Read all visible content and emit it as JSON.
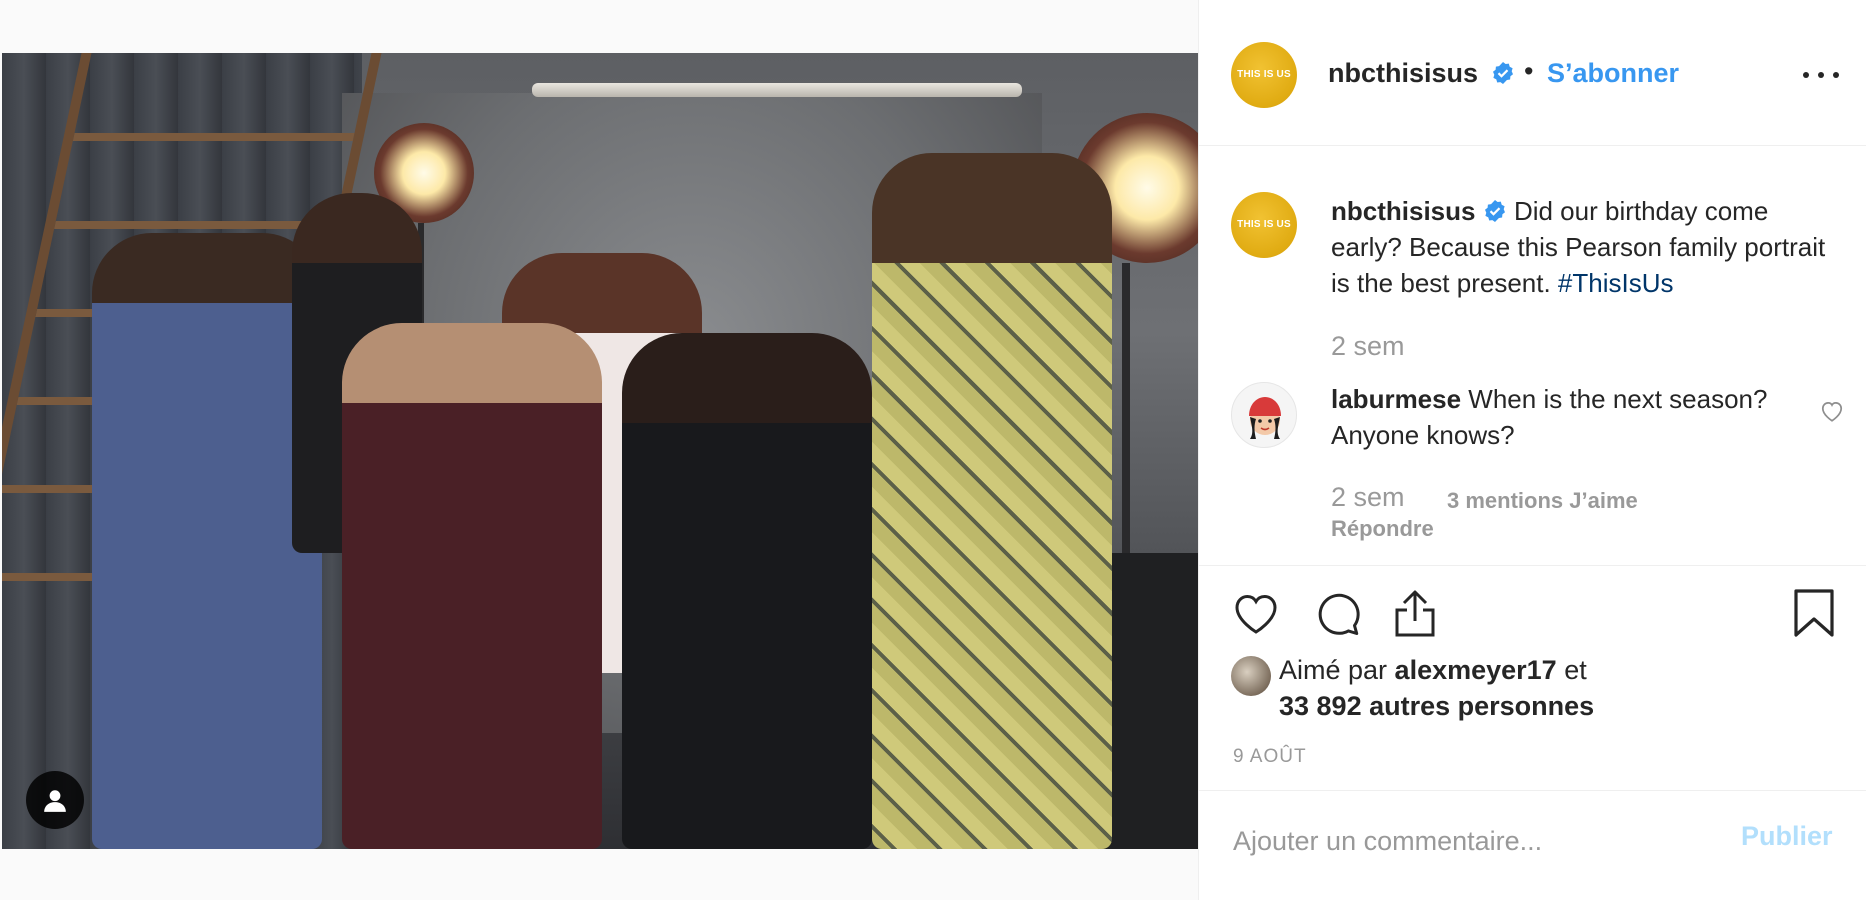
{
  "post": {
    "image_alt": "",
    "user_tag_icon": "person-icon"
  },
  "header": {
    "avatar_text_small": "",
    "avatar_text": "THIS IS US",
    "username": "nbcthisisus",
    "verified_icon": "verified-badge-icon",
    "separator": "•",
    "follow_label": "S’abonner",
    "more_icon": "more-horizontal-icon"
  },
  "caption": {
    "username": "nbcthisisus",
    "text": " Did our birthday come early? Because this Pearson family portrait is the best present. ",
    "hashtag": "#ThisIsUs",
    "time": "2 sem"
  },
  "comment": {
    "username": "laburmese",
    "text": " When is the next season? Anyone knows?",
    "time": "2 sem",
    "likes": "3 mentions J’aime",
    "reply": "Répondre",
    "heart_icon": "heart-outline-icon"
  },
  "actions": {
    "like_icon": "heart-outline-icon",
    "comment_icon": "comment-bubble-icon",
    "share_icon": "share-upload-icon",
    "save_icon": "bookmark-icon"
  },
  "likes": {
    "prefix": "Aimé par ",
    "user": "alexmeyer17",
    "mid": " et ",
    "others": "33 892 autres personnes"
  },
  "date": "9 août",
  "add_comment": {
    "placeholder": "Ajouter un commentaire...",
    "publish_label": "Publier"
  },
  "colors": {
    "accent_blue": "#3897f0",
    "hashtag": "#003569",
    "muted": "#999999",
    "brand_gold": "#e0ab12"
  }
}
